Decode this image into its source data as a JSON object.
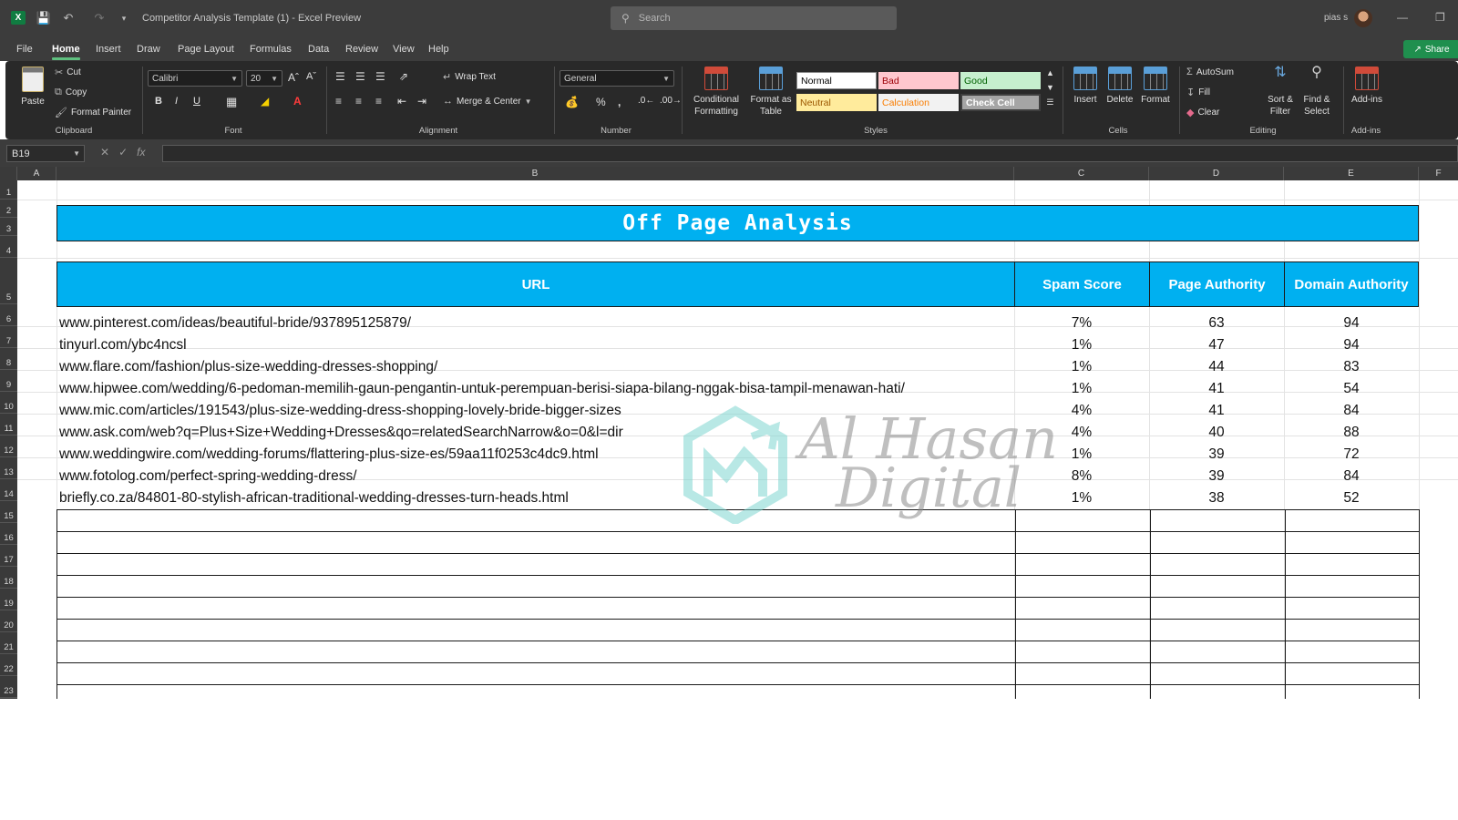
{
  "titlebar": {
    "doc_title": "Competitor Analysis Template (1)  -  Excel Preview",
    "search_placeholder": "Search",
    "user": "pias s"
  },
  "menu": {
    "tabs": [
      "File",
      "Home",
      "Insert",
      "Draw",
      "Page Layout",
      "Formulas",
      "Data",
      "Review",
      "View",
      "Help"
    ],
    "active": "Home",
    "share": "Share"
  },
  "ribbon": {
    "clipboard": {
      "paste": "Paste",
      "cut": "Cut",
      "copy": "Copy",
      "format_painter": "Format Painter",
      "label": "Clipboard"
    },
    "font": {
      "name": "Calibri",
      "size": "20",
      "label": "Font"
    },
    "alignment": {
      "wrap": "Wrap Text",
      "merge": "Merge & Center",
      "label": "Alignment"
    },
    "number": {
      "format": "General",
      "label": "Number"
    },
    "styles": {
      "conditional": "Conditional Formatting",
      "format_table": "Format as Table",
      "cells": [
        {
          "label": "Normal",
          "bg": "#ffffff",
          "fg": "#000000"
        },
        {
          "label": "Bad",
          "bg": "#ffc7ce",
          "fg": "#9c0006"
        },
        {
          "label": "Good",
          "bg": "#c6efce",
          "fg": "#006100"
        },
        {
          "label": "Neutral",
          "bg": "#ffeb9c",
          "fg": "#9c5700"
        },
        {
          "label": "Calculation",
          "bg": "#f2f2f2",
          "fg": "#fa7d00"
        },
        {
          "label": "Check Cell",
          "bg": "#a5a5a5",
          "fg": "#ffffff"
        }
      ],
      "label": "Styles"
    },
    "cells": {
      "insert": "Insert",
      "delete": "Delete",
      "format": "Format",
      "label": "Cells"
    },
    "editing": {
      "autosum": "AutoSum",
      "fill": "Fill",
      "clear": "Clear",
      "sort": "Sort & Filter",
      "find": "Find & Select",
      "label": "Editing"
    },
    "addins": {
      "addins": "Add-ins",
      "label": "Add-ins"
    }
  },
  "formula_bar": {
    "name_box": "B19",
    "fx": "fx",
    "value": ""
  },
  "columns": [
    "A",
    "B",
    "C",
    "D",
    "E",
    "F"
  ],
  "rows": [
    "1",
    "2",
    "3",
    "4",
    "5",
    "6",
    "7",
    "8",
    "9",
    "10",
    "11",
    "12",
    "13",
    "14",
    "15",
    "16",
    "17",
    "18",
    "19",
    "20",
    "21",
    "22",
    "23"
  ],
  "sheet": {
    "title": "Off Page Analysis",
    "headers": [
      "URL",
      "Spam Score",
      "Page Authority",
      "Domain Authority"
    ],
    "data": [
      [
        "www.pinterest.com/ideas/beautiful-bride/937895125879/",
        "7%",
        "63",
        "94"
      ],
      [
        "tinyurl.com/ybc4ncsl",
        "1%",
        "47",
        "94"
      ],
      [
        "www.flare.com/fashion/plus-size-wedding-dresses-shopping/",
        "1%",
        "44",
        "83"
      ],
      [
        "www.hipwee.com/wedding/6-pedoman-memilih-gaun-pengantin-untuk-perempuan-berisi-siapa-bilang-nggak-bisa-tampil-menawan-hati/",
        "1%",
        "41",
        "54"
      ],
      [
        "www.mic.com/articles/191543/plus-size-wedding-dress-shopping-lovely-bride-bigger-sizes",
        "4%",
        "41",
        "84"
      ],
      [
        "www.ask.com/web?q=Plus+Size+Wedding+Dresses&qo=relatedSearchNarrow&o=0&l=dir",
        "4%",
        "40",
        "88"
      ],
      [
        "www.weddingwire.com/wedding-forums/flattering-plus-size-es/59aa11f0253c4dc9.html",
        "1%",
        "39",
        "72"
      ],
      [
        "www.fotolog.com/perfect-spring-wedding-dress/",
        "8%",
        "39",
        "84"
      ],
      [
        "briefly.co.za/84801-80-stylish-african-traditional-wedding-dresses-turn-heads.html",
        "1%",
        "38",
        "52"
      ]
    ]
  },
  "watermark": {
    "line1": "Al Hasan",
    "line2": "Digital"
  }
}
